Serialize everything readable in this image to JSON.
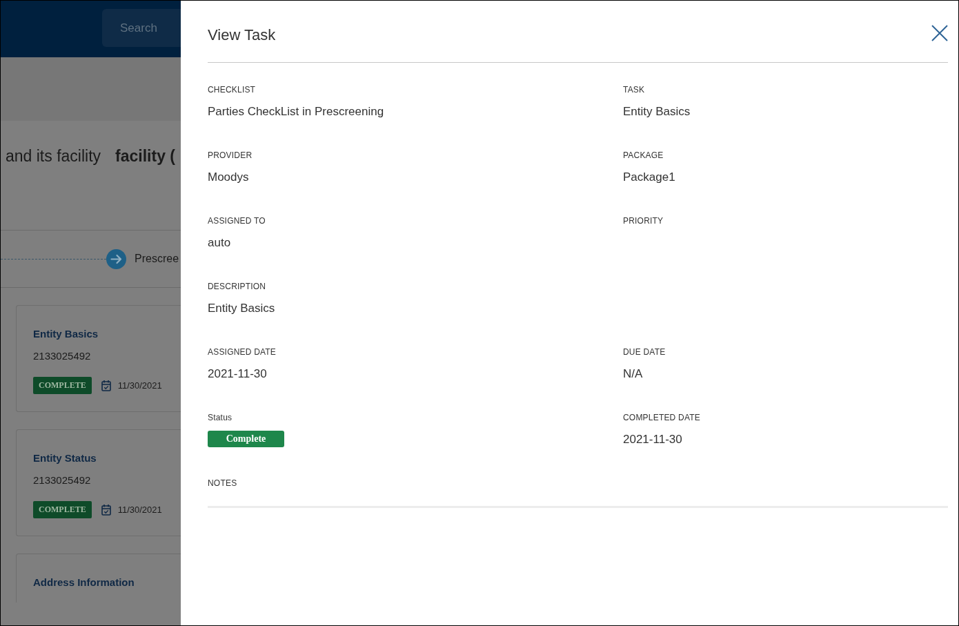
{
  "header": {
    "search": {
      "placeholder": "Search"
    }
  },
  "page_heading": {
    "text": "and its facility",
    "bold_text": "facility ("
  },
  "workflow": {
    "step_label": "Prescree"
  },
  "task_cards": [
    {
      "title": "Entity Basics",
      "number": "2133025492",
      "status": "COMPLETE",
      "date": "11/30/2021"
    },
    {
      "title": "Entity Status",
      "number": "2133025492",
      "status": "COMPLETE",
      "date": "11/30/2021"
    },
    {
      "title": "Address Information"
    }
  ],
  "panel": {
    "title": "View Task",
    "field_rows": [
      {
        "fields": [
          {
            "kind": "text",
            "label": "CHECKLIST",
            "value": "Parties CheckList in Prescreening"
          },
          {
            "kind": "text",
            "label": "TASK",
            "value": "Entity Basics"
          }
        ]
      },
      {
        "fields": [
          {
            "kind": "text",
            "label": "PROVIDER",
            "value": "Moodys"
          },
          {
            "kind": "text",
            "label": "PACKAGE",
            "value": "Package1"
          }
        ]
      },
      {
        "fields": [
          {
            "kind": "text",
            "label": "ASSIGNED TO",
            "value": "auto"
          },
          {
            "kind": "text",
            "label": "PRIORITY"
          }
        ]
      },
      {
        "fields": [
          {
            "kind": "text",
            "label": "DESCRIPTION",
            "value": "Entity Basics"
          }
        ]
      },
      {
        "fields": [
          {
            "kind": "text",
            "label": "ASSIGNED DATE",
            "value": "2021-11-30"
          },
          {
            "kind": "text",
            "label": "DUE DATE",
            "value": "N/A"
          }
        ]
      },
      {
        "fields": [
          {
            "kind": "badge",
            "label": "Status",
            "value": "Complete"
          },
          {
            "kind": "text",
            "label": "COMPLETED DATE",
            "value": "2021-11-30"
          }
        ]
      },
      {
        "fields": [
          {
            "kind": "notes",
            "label": "NOTES"
          }
        ]
      }
    ]
  }
}
